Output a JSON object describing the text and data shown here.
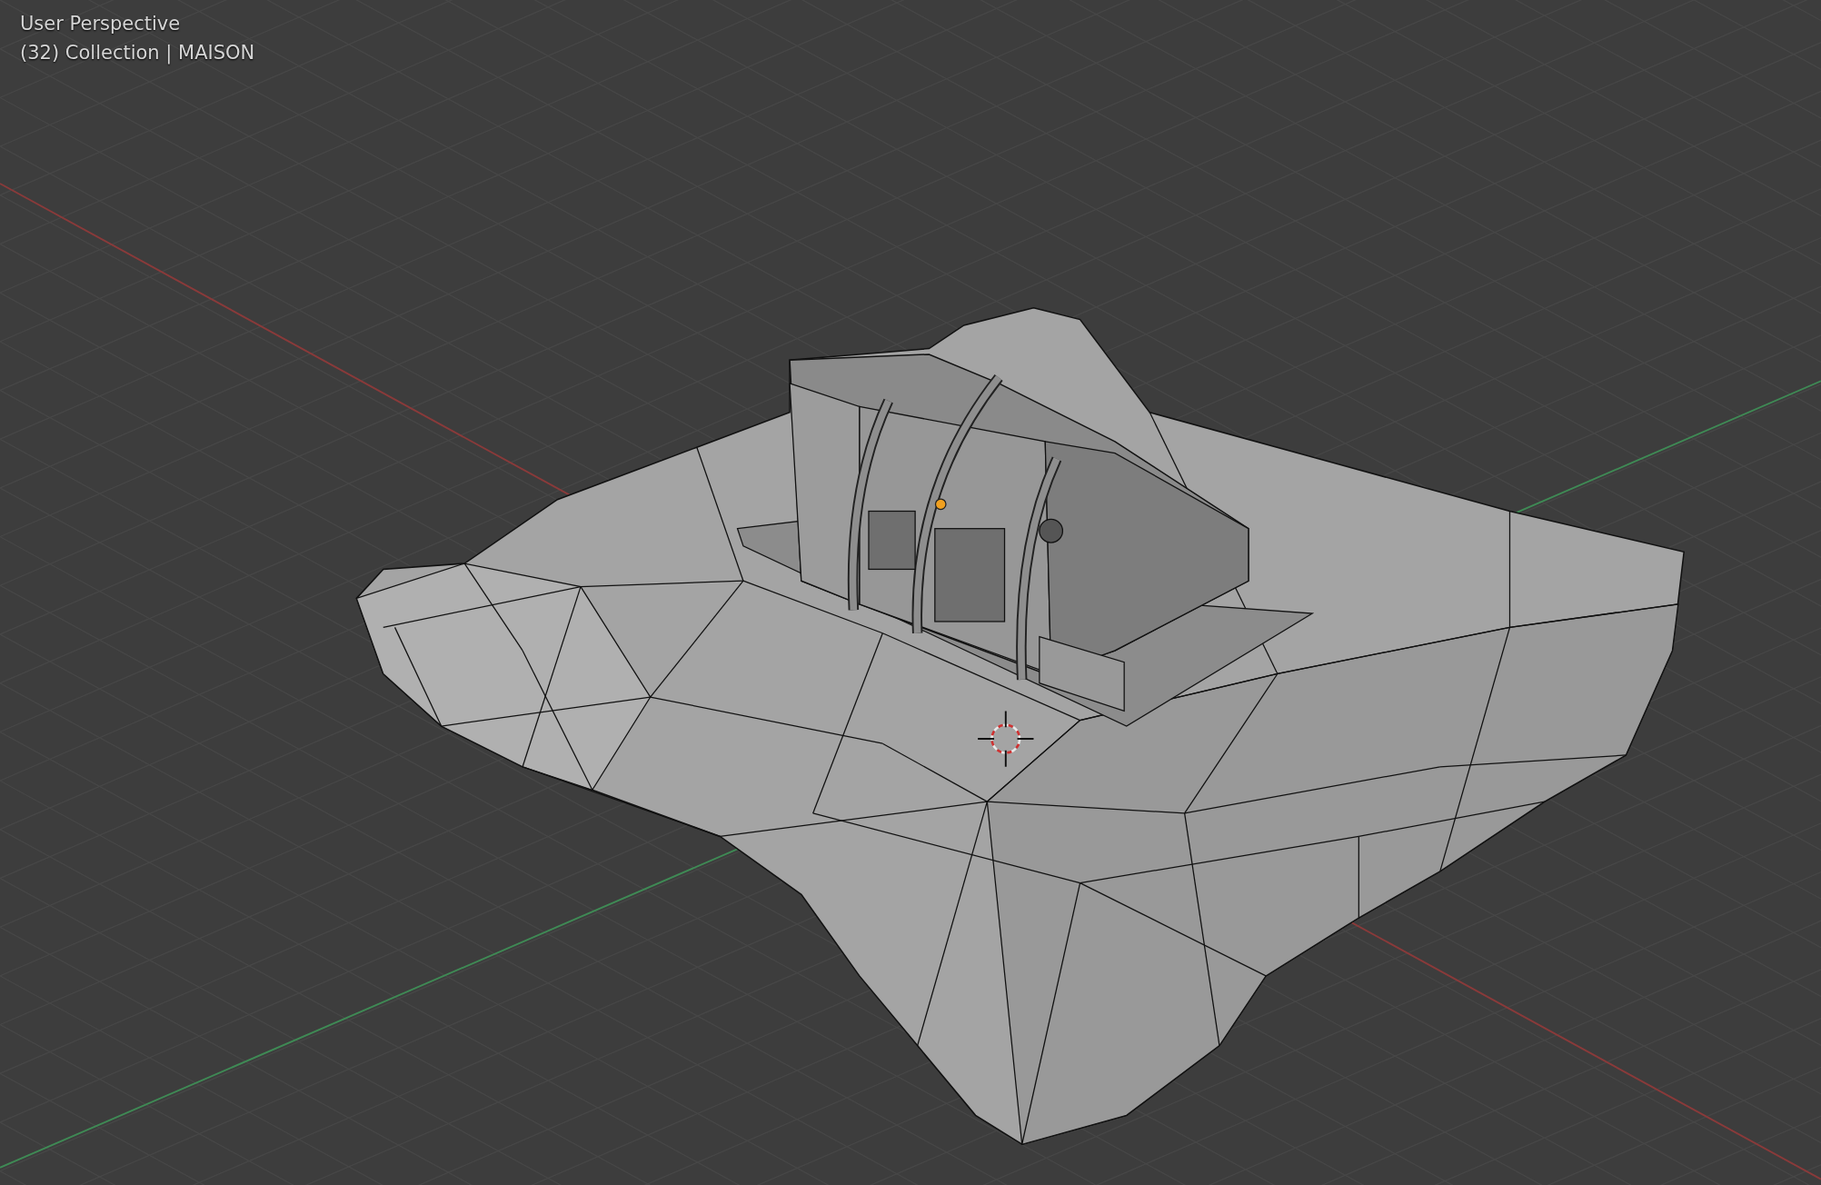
{
  "viewport": {
    "view_name": "User Perspective",
    "object_info": "(32) Collection | MAISON"
  }
}
